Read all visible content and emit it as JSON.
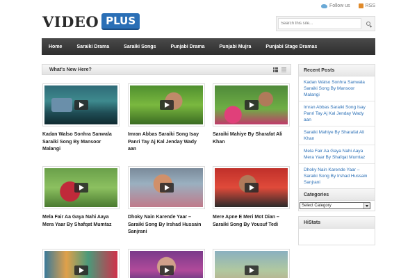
{
  "top_links": {
    "twitter": "Follow us",
    "rss": "RSS"
  },
  "logo": {
    "word": "VIDEO",
    "badge": "PLUS"
  },
  "search": {
    "placeholder": "Search this site..."
  },
  "nav": {
    "items": [
      "Home",
      "Saraiki Drama",
      "Saraiki Songs",
      "Punjabi Drama",
      "Punjabi Mujra",
      "Punjabi Stage Dramas"
    ]
  },
  "main": {
    "heading": "What's New Here?",
    "videos": [
      {
        "title": "Kadan Walso Sonhra Sanwala Saraiki Song By Mansoor Malangi"
      },
      {
        "title": "Imran Abbas Saraiki Song Isay Panri Tay Aj Kal Jenday Wady aan"
      },
      {
        "title": "Saraiki Mahiye By Sharafat Ali Khan"
      },
      {
        "title": "Mela Fair Aa Gaya Nahi Aaya Mera Yaar By Shafqat Mumtaz"
      },
      {
        "title": "Dhoky Nain Karende Yaar – Saraiki Song By Irshad Hussain Sanjrani"
      },
      {
        "title": "Mere Apne E Meri Mot Dian – Saraiki Song By Yousuf Tedi"
      },
      {
        "title": ""
      },
      {
        "title": ""
      },
      {
        "title": ""
      }
    ]
  },
  "sidebar": {
    "recent_posts": {
      "heading": "Recent Posts",
      "items": [
        "Kadan Walso Sonhra Sanwala Saraiki Song By Mansoor Malangi",
        "Imran Abbas Saraiki Song Isay Panri Tay Aj Kal Jenday Wady aan",
        "Saraiki Mahiye By Sharafat Ali Khan",
        "Mela Fair Aa Gaya Nahi Aaya Mera Yaar By Shafqat Mumtaz",
        "Dhoky Nain Karende Yaar – Saraiki Song By Irshad Hussain Sanjrani"
      ]
    },
    "categories": {
      "heading": "Categories",
      "selected": "Select Category"
    },
    "histats": {
      "heading": "HiStats"
    }
  },
  "colors": {
    "accent": "#2a6fb6",
    "nav_bg": "#3a3a3a",
    "link": "#2a6fb6"
  }
}
